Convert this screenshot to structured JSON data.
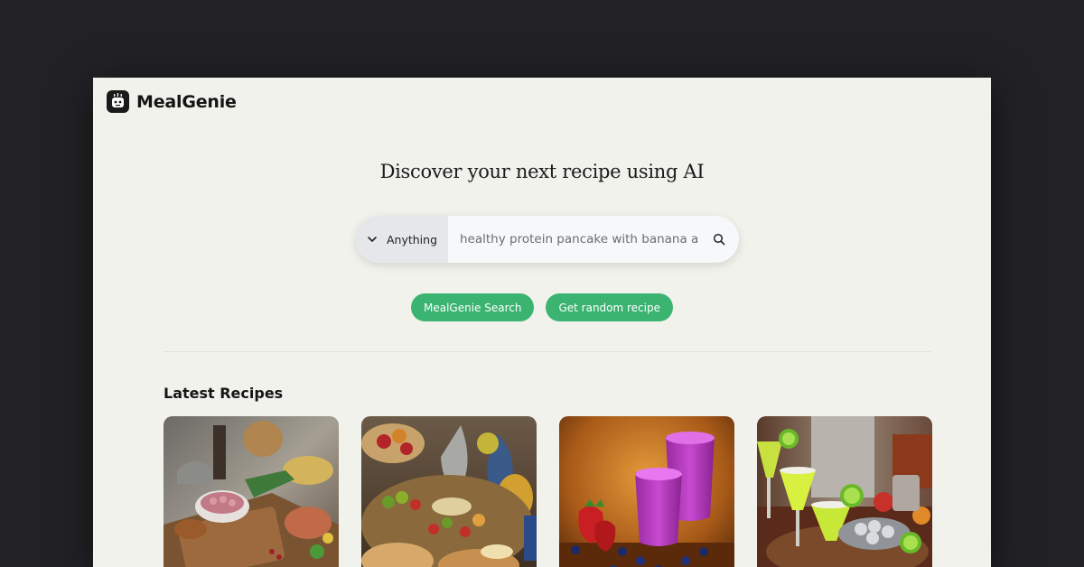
{
  "app": {
    "name": "MealGenie",
    "logo_icon": "chef-robot-icon"
  },
  "hero": {
    "title": "Discover your next recipe using AI"
  },
  "search": {
    "category_selected": "Anything",
    "category_icon": "chevron-down-icon",
    "query_value": "healthy protein pancake with banana and",
    "search_icon": "search-icon"
  },
  "actions": {
    "mealgenie_search_label": "MealGenie Search",
    "random_recipe_label": "Get random recipe"
  },
  "latest": {
    "title": "Latest Recipes",
    "cards": [
      {
        "image": "kitchen-table-fish-vegetables"
      },
      {
        "image": "feast-fruits-vegetables-pastries"
      },
      {
        "image": "purple-berry-smoothies"
      },
      {
        "image": "lime-margaritas-cocktails"
      }
    ]
  },
  "colors": {
    "background": "#222125",
    "page": "#f1f2ec",
    "accent": "#3bb371",
    "text": "#151515"
  }
}
